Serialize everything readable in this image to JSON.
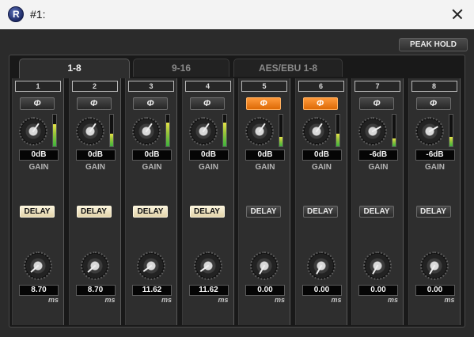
{
  "window": {
    "title": "#1:",
    "close_icon": "close-icon",
    "app_icon": "app-logo-icon"
  },
  "toolbar": {
    "peak_hold_label": "PEAK HOLD"
  },
  "tabs": [
    {
      "label": "1-8",
      "active": true
    },
    {
      "label": "9-16",
      "active": false
    },
    {
      "label": "AES/EBU 1-8",
      "active": false
    }
  ],
  "labels": {
    "gain": "GAIN",
    "delay": "DELAY",
    "ms": "ms",
    "phase_symbol": "Φ"
  },
  "channels": [
    {
      "number": "1",
      "phase_on": false,
      "gain": "0dB",
      "meter_level": 0.7,
      "delay_on": true,
      "delay": "8.70"
    },
    {
      "number": "2",
      "phase_on": false,
      "gain": "0dB",
      "meter_level": 0.4,
      "delay_on": true,
      "delay": "8.70"
    },
    {
      "number": "3",
      "phase_on": false,
      "gain": "0dB",
      "meter_level": 0.75,
      "delay_on": true,
      "delay": "11.62"
    },
    {
      "number": "4",
      "phase_on": false,
      "gain": "0dB",
      "meter_level": 0.75,
      "delay_on": true,
      "delay": "11.62"
    },
    {
      "number": "5",
      "phase_on": true,
      "gain": "0dB",
      "meter_level": 0.3,
      "delay_on": false,
      "delay": "0.00"
    },
    {
      "number": "6",
      "phase_on": true,
      "gain": "0dB",
      "meter_level": 0.4,
      "delay_on": false,
      "delay": "0.00"
    },
    {
      "number": "7",
      "phase_on": false,
      "gain": "-6dB",
      "meter_level": 0.25,
      "delay_on": false,
      "delay": "0.00"
    },
    {
      "number": "8",
      "phase_on": false,
      "gain": "-6dB",
      "meter_level": 0.3,
      "delay_on": false,
      "delay": "0.00"
    }
  ],
  "colors": {
    "phase_active": "#f07a14",
    "delay_active": "#efe4c2",
    "meter": "#7fd13a"
  }
}
